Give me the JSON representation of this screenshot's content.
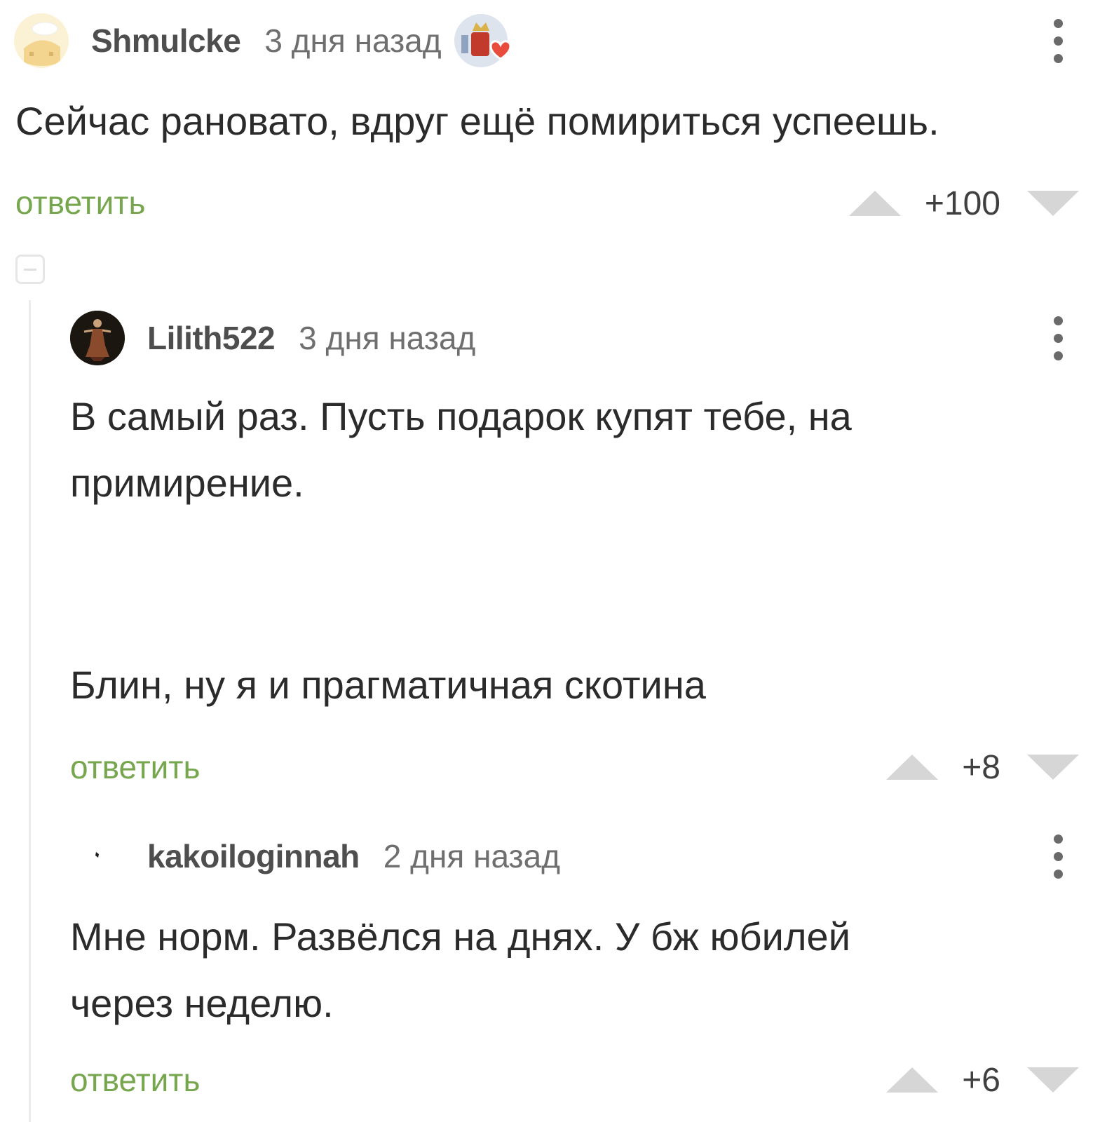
{
  "comments": [
    {
      "username": "Shmulcke",
      "timestamp": "3 дня назад",
      "text": "Сейчас рановато, вдруг ещё помириться успеешь.",
      "reply_label": "ответить",
      "rating": "+100",
      "avatar_icon": "cartoon-face-avatar",
      "badge_icon": "coat-of-arms-heart-badge"
    },
    {
      "username": "Lilith522",
      "timestamp": "3 дня назад",
      "text_lines": [
        "В самый раз. Пусть подарок купят тебе, на",
        "примирение."
      ],
      "text_extra": "Блин, ну я и прагматичная скотина",
      "reply_label": "ответить",
      "rating": "+8",
      "avatar_icon": "dark-figure-avatar"
    },
    {
      "username": "kakoiloginnah",
      "timestamp": "2 дня назад",
      "text_lines": [
        "Мне норм. Развёлся на днях. У бж юбилей",
        "через неделю."
      ],
      "reply_label": "ответить",
      "rating": "+6",
      "avatar_icon": "dot-avatar"
    }
  ],
  "colors": {
    "reply_green": "#76a64d",
    "vote_arrow": "#d6d6d6",
    "text": "#2b2b2b"
  }
}
